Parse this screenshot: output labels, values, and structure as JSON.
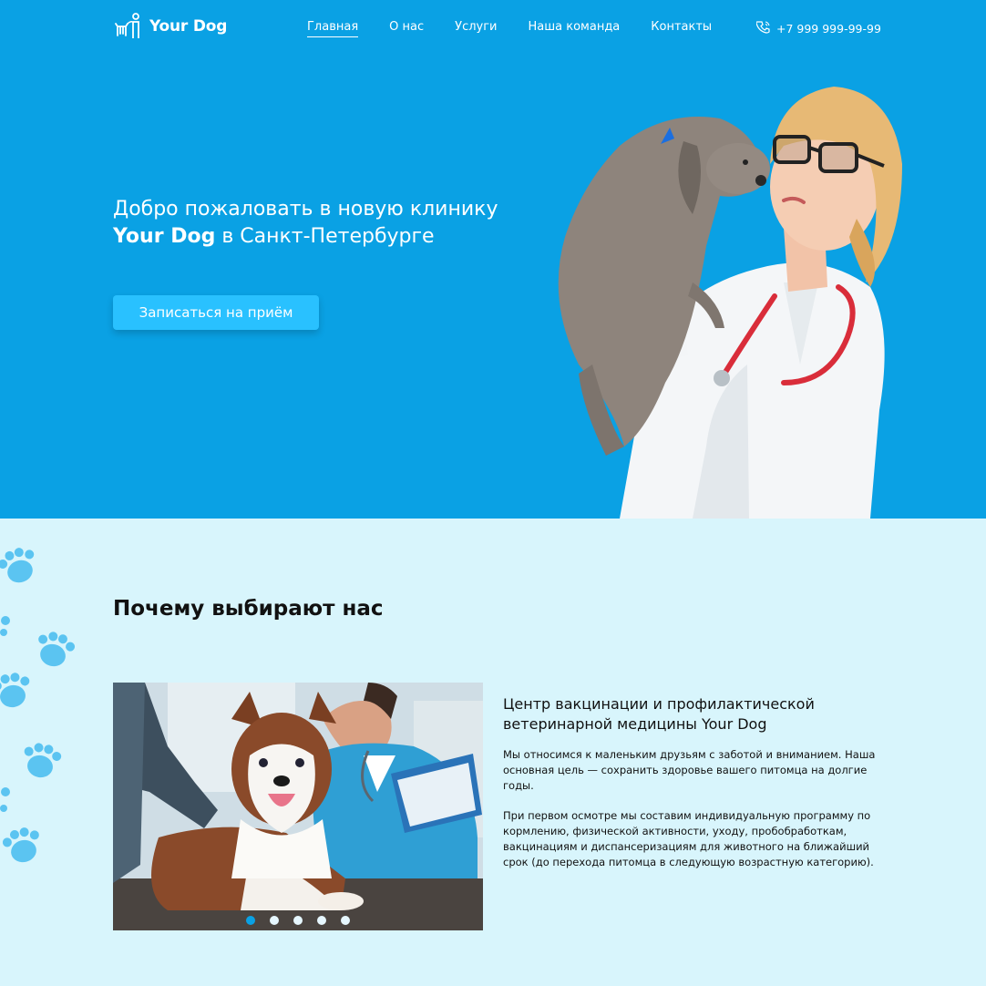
{
  "header": {
    "logo_text": "Your Dog",
    "nav": [
      {
        "label": "Главная",
        "active": true
      },
      {
        "label": "О нас"
      },
      {
        "label": "Услуги"
      },
      {
        "label": "Наша команда"
      },
      {
        "label": "Контакты"
      }
    ],
    "phone": "+7 999 999-99-99"
  },
  "hero": {
    "title_line1": "Добро пожаловать в новую клинику",
    "title_brand": "Your Dog",
    "title_line2_rest": " в Санкт-Петербурге",
    "cta_label": "Записаться на приём"
  },
  "why": {
    "title": "Почему выбирают нас",
    "info_title": "Центр вакцинации и профилактической ветеринарной медицины Your Dog",
    "paragraph1": "Мы относимся к маленьким друзьям с заботой и вниманием. Наша основная цель — сохранить здоровье вашего питомца на долгие годы.",
    "paragraph2": "При первом осмотре мы составим индивидуальную программу по кормлению, физической активности, уходу, пробобработкам, вакцинациям и диспансеризациям для животного на ближайший срок (до перехода питомца в следующую возрастную категорию).",
    "slider_dots": 5,
    "active_dot": 1
  },
  "colors": {
    "hero_bg": "#0aa1e4",
    "button": "#29c1ff",
    "section_bg": "#d8f5fc",
    "paw": "#5bc4f1"
  }
}
